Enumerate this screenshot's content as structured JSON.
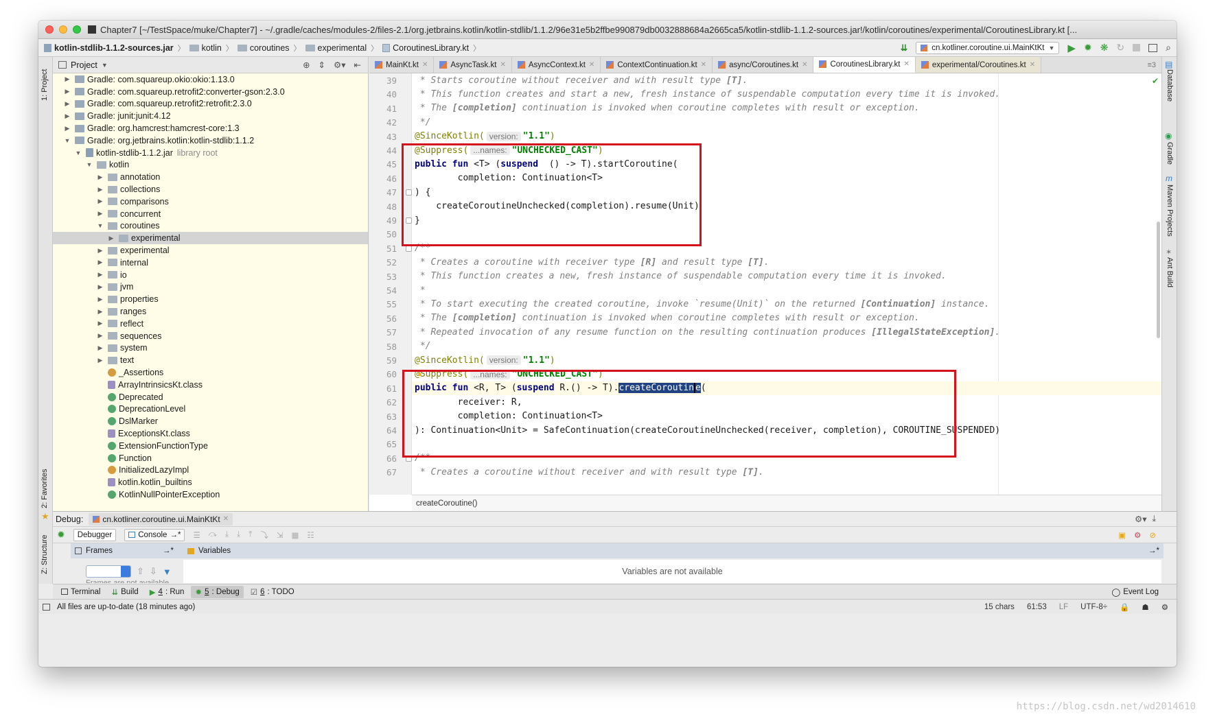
{
  "window": {
    "title": "Chapter7 [~/TestSpace/muke/Chapter7] - ~/.gradle/caches/modules-2/files-2.1/org.jetbrains.kotlin/kotlin-stdlib/1.1.2/96e31e5b2ffbe990879db0032888684a2665ca5/kotlin-stdlib-1.1.2-sources.jar!/kotlin/coroutines/experimental/CoroutinesLibrary.kt [..."
  },
  "navbar": {
    "crumbs": [
      "kotlin-stdlib-1.1.2-sources.jar",
      "kotlin",
      "coroutines",
      "experimental",
      "CoroutinesLibrary.kt"
    ],
    "run_config": "cn.kotliner.coroutine.ui.MainKtKt"
  },
  "side": {
    "project": "1: Project",
    "favorites": "2: Favorites",
    "structure": "Z: Structure",
    "database": "Database",
    "gradle": "Gradle",
    "maven": "Maven Projects",
    "ant": "Ant Build"
  },
  "project": {
    "header": "Project",
    "tree": [
      {
        "label": "Gradle: com.squareup.okio:okio:1.13.0",
        "depth": 0,
        "arrow": "▶",
        "icon": "lib"
      },
      {
        "label": "Gradle: com.squareup.retrofit2:converter-gson:2.3.0",
        "depth": 0,
        "arrow": "▶",
        "icon": "lib"
      },
      {
        "label": "Gradle: com.squareup.retrofit2:retrofit:2.3.0",
        "depth": 0,
        "arrow": "▶",
        "icon": "lib"
      },
      {
        "label": "Gradle: junit:junit:4.12",
        "depth": 0,
        "arrow": "▶",
        "icon": "lib"
      },
      {
        "label": "Gradle: org.hamcrest:hamcrest-core:1.3",
        "depth": 0,
        "arrow": "▶",
        "icon": "lib"
      },
      {
        "label": "Gradle: org.jetbrains.kotlin:kotlin-stdlib:1.1.2",
        "depth": 0,
        "arrow": "▼",
        "icon": "lib"
      },
      {
        "label": "kotlin-stdlib-1.1.2.jar",
        "note": "library root",
        "depth": 1,
        "arrow": "▼",
        "icon": "jar"
      },
      {
        "label": "kotlin",
        "depth": 2,
        "arrow": "▼",
        "icon": "pkg"
      },
      {
        "label": "annotation",
        "depth": 3,
        "arrow": "▶",
        "icon": "pkg"
      },
      {
        "label": "collections",
        "depth": 3,
        "arrow": "▶",
        "icon": "pkg"
      },
      {
        "label": "comparisons",
        "depth": 3,
        "arrow": "▶",
        "icon": "pkg"
      },
      {
        "label": "concurrent",
        "depth": 3,
        "arrow": "▶",
        "icon": "pkg"
      },
      {
        "label": "coroutines",
        "depth": 3,
        "arrow": "▼",
        "icon": "pkg"
      },
      {
        "label": "experimental",
        "depth": 4,
        "arrow": "▶",
        "icon": "pkg",
        "selected": true
      },
      {
        "label": "experimental",
        "depth": 3,
        "arrow": "▶",
        "icon": "pkg"
      },
      {
        "label": "internal",
        "depth": 3,
        "arrow": "▶",
        "icon": "pkg"
      },
      {
        "label": "io",
        "depth": 3,
        "arrow": "▶",
        "icon": "pkg"
      },
      {
        "label": "jvm",
        "depth": 3,
        "arrow": "▶",
        "icon": "pkg"
      },
      {
        "label": "properties",
        "depth": 3,
        "arrow": "▶",
        "icon": "pkg"
      },
      {
        "label": "ranges",
        "depth": 3,
        "arrow": "▶",
        "icon": "pkg"
      },
      {
        "label": "reflect",
        "depth": 3,
        "arrow": "▶",
        "icon": "pkg"
      },
      {
        "label": "sequences",
        "depth": 3,
        "arrow": "▶",
        "icon": "pkg"
      },
      {
        "label": "system",
        "depth": 3,
        "arrow": "▶",
        "icon": "pkg"
      },
      {
        "label": "text",
        "depth": 3,
        "arrow": "▶",
        "icon": "pkg"
      },
      {
        "label": "_Assertions",
        "depth": 3,
        "arrow": "",
        "icon": "a"
      },
      {
        "label": "ArrayIntrinsicsKt.class",
        "depth": 3,
        "arrow": "",
        "icon": "f"
      },
      {
        "label": "Deprecated",
        "depth": 3,
        "arrow": "",
        "icon": "c"
      },
      {
        "label": "DeprecationLevel",
        "depth": 3,
        "arrow": "",
        "icon": "c"
      },
      {
        "label": "DslMarker",
        "depth": 3,
        "arrow": "",
        "icon": "c"
      },
      {
        "label": "ExceptionsKt.class",
        "depth": 3,
        "arrow": "",
        "icon": "f"
      },
      {
        "label": "ExtensionFunctionType",
        "depth": 3,
        "arrow": "",
        "icon": "c"
      },
      {
        "label": "Function",
        "depth": 3,
        "arrow": "",
        "icon": "c"
      },
      {
        "label": "InitializedLazyImpl",
        "depth": 3,
        "arrow": "",
        "icon": "a"
      },
      {
        "label": "kotlin.kotlin_builtins",
        "depth": 3,
        "arrow": "",
        "icon": "f"
      },
      {
        "label": "KotlinNullPointerException",
        "depth": 3,
        "arrow": "",
        "icon": "c"
      }
    ]
  },
  "editor": {
    "tabs": [
      {
        "label": "MainKt.kt",
        "active": false
      },
      {
        "label": "AsyncTask.kt",
        "active": false
      },
      {
        "label": "AsyncContext.kt",
        "active": false
      },
      {
        "label": "ContextContinuation.kt",
        "active": false
      },
      {
        "label": "async/Coroutines.kt",
        "active": false
      },
      {
        "label": "CoroutinesLibrary.kt",
        "active": true
      },
      {
        "label": "experimental/Coroutines.kt",
        "active": false
      }
    ],
    "tabs_more": "≡3",
    "breadcrumb": "createCoroutine()"
  },
  "debug": {
    "title": "Debug:",
    "config": "cn.kotliner.coroutine.ui.MainKtKt",
    "debugger_tab": "Debugger",
    "console_tab": "Console",
    "frames": "Frames",
    "variables": "Variables",
    "vars_empty": "Variables are not available",
    "frames_empty": "Frames are not available"
  },
  "bottombar": {
    "items": [
      {
        "prefix": "",
        "label": "Terminal"
      },
      {
        "prefix": "",
        "label": "Build"
      },
      {
        "prefix": "4",
        "label": ": Run"
      },
      {
        "prefix": "5",
        "label": ": Debug",
        "active": true
      },
      {
        "prefix": "6",
        "label": ": TODO"
      }
    ],
    "event_log": "Event Log"
  },
  "status": {
    "message": "All files are up-to-date (18 minutes ago)",
    "chars": "15 chars",
    "position": "61:53",
    "line_sep": "LF",
    "encoding": "UTF-8÷"
  },
  "watermark": "https://blog.csdn.net/wd2014610"
}
